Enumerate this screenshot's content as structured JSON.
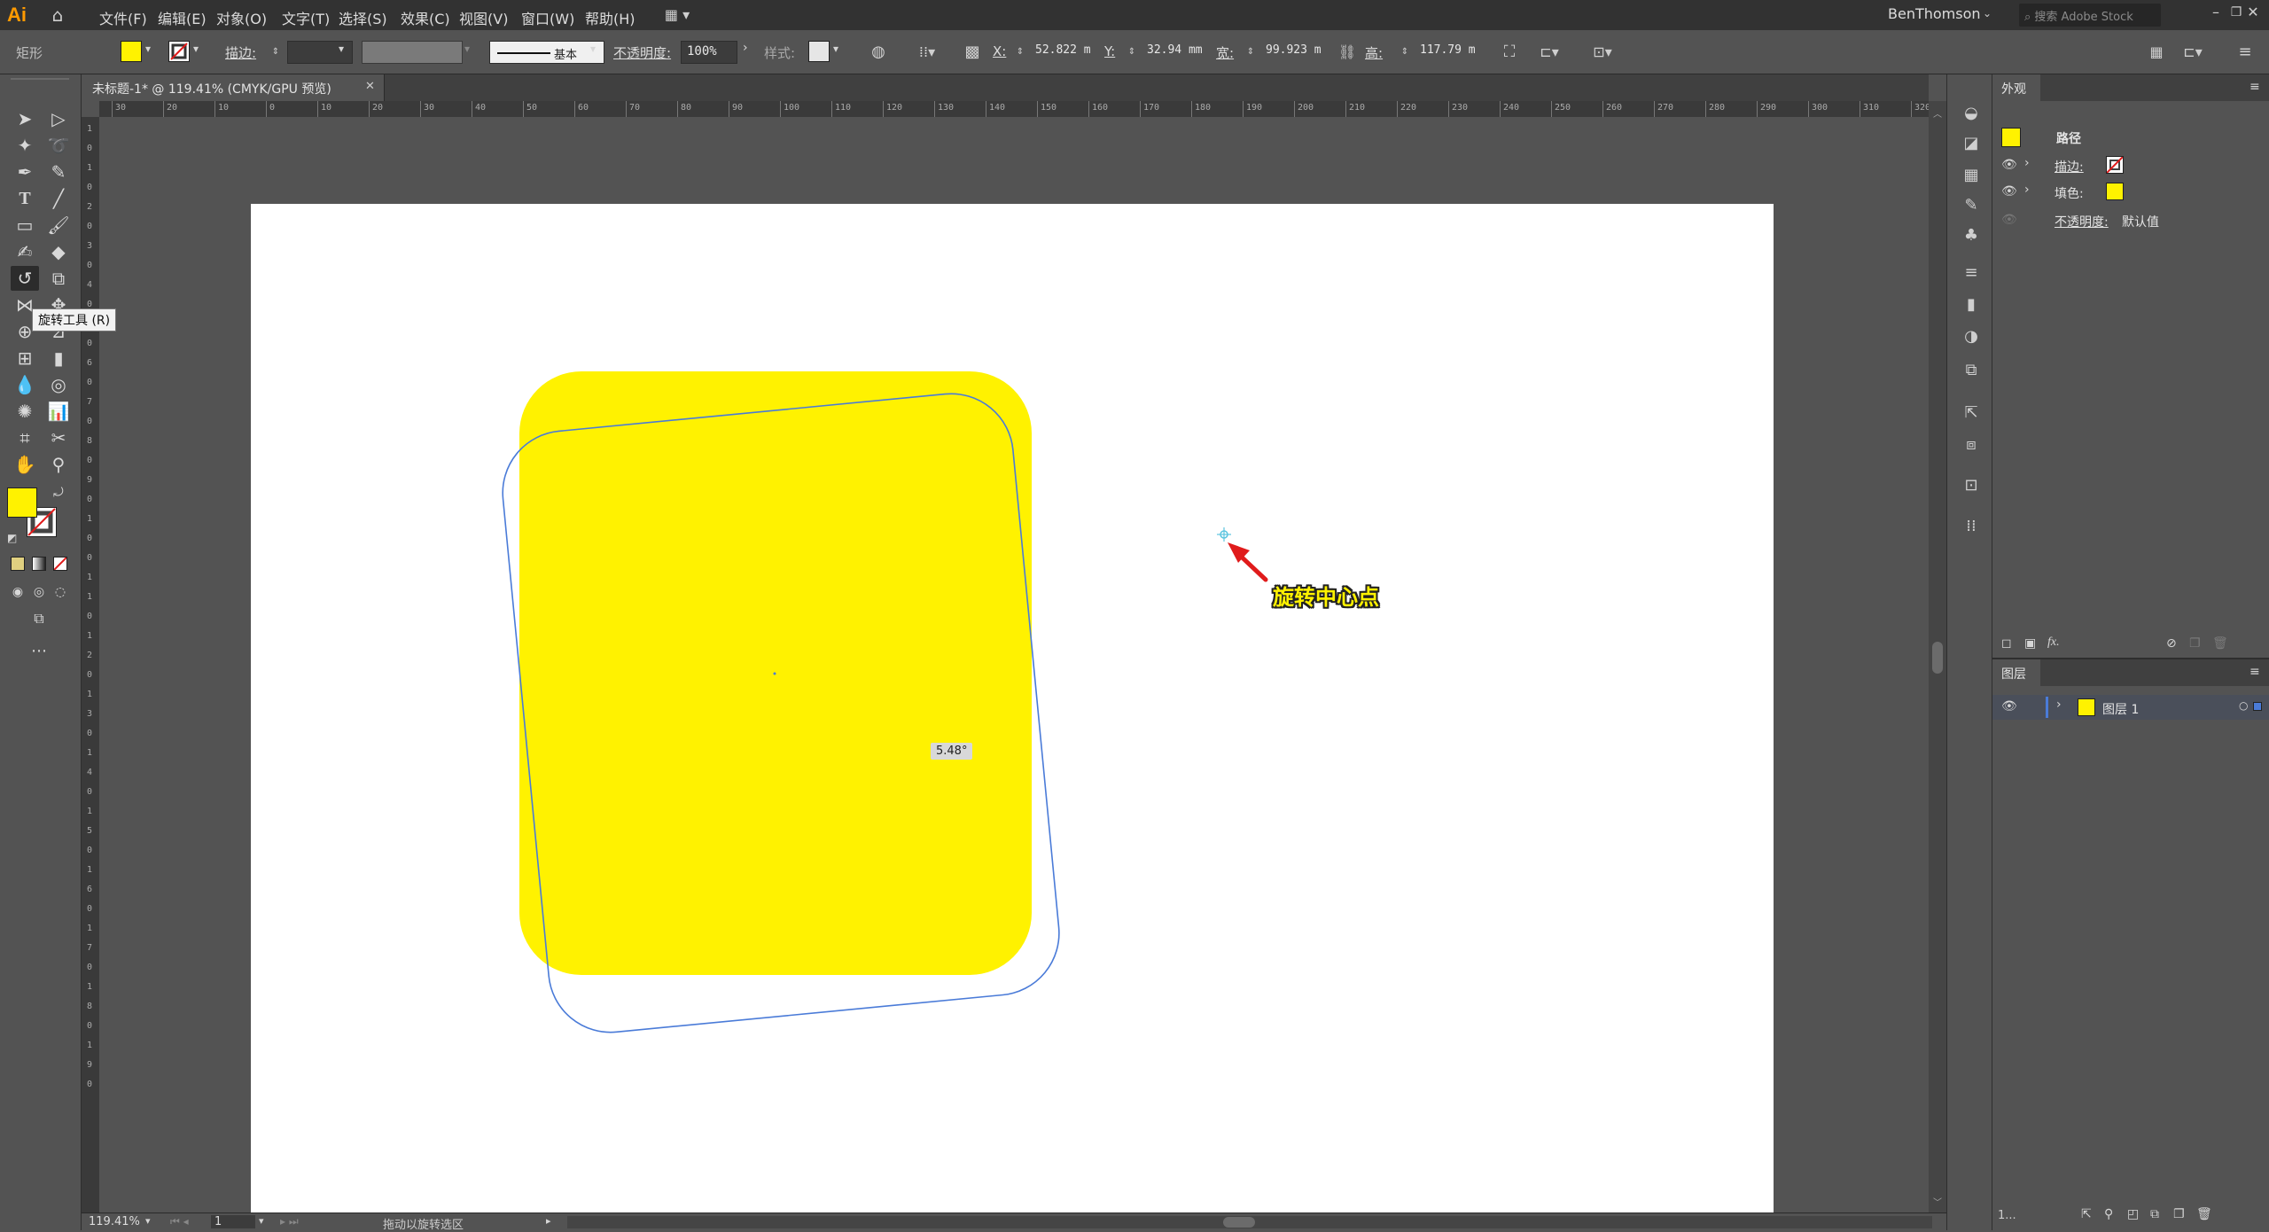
{
  "app": {
    "logo": "Ai"
  },
  "menu": [
    "文件(F)",
    "编辑(E)",
    "对象(O)",
    "文字(T)",
    "选择(S)",
    "效果(C)",
    "视图(V)",
    "窗口(W)",
    "帮助(H)"
  ],
  "user": {
    "name": "BenThomson",
    "search_placeholder": "搜索 Adobe Stock"
  },
  "control": {
    "object_type": "矩形",
    "stroke_label": "描边:",
    "stroke_profile": "基本",
    "opacity_label": "不透明度:",
    "opacity_value": "100%",
    "style_label": "样式:",
    "x_label": "X:",
    "x_value": "52.822 m",
    "y_label": "Y:",
    "y_value": "32.94 mm",
    "w_label": "宽:",
    "w_value": "99.923 m",
    "h_label": "高:",
    "h_value": "117.79 m",
    "fill_color": "#fff200"
  },
  "document_tab": {
    "title": "未标题-1* @ 119.41% (CMYK/GPU 预览)",
    "close": "✕"
  },
  "ruler_top_ticks": [
    "30",
    "20",
    "10",
    "0",
    "10",
    "20",
    "30",
    "40",
    "50",
    "60",
    "70",
    "80",
    "90",
    "100",
    "110",
    "120",
    "130",
    "140",
    "150",
    "160",
    "170",
    "180",
    "190",
    "200",
    "210",
    "220",
    "230",
    "240",
    "250",
    "260",
    "270",
    "280",
    "290",
    "300",
    "310",
    "320"
  ],
  "ruler_left_ticks": [
    "1",
    "0",
    "1",
    "0",
    "2",
    "0",
    "3",
    "0",
    "4",
    "0",
    "5",
    "0",
    "6",
    "0",
    "7",
    "0",
    "8",
    "0",
    "9",
    "0",
    "1",
    "0",
    "0",
    "1",
    "1",
    "0",
    "1",
    "2",
    "0",
    "1",
    "3",
    "0",
    "1",
    "4",
    "0",
    "1",
    "5",
    "0",
    "1",
    "6",
    "0",
    "1",
    "7",
    "0",
    "1",
    "8",
    "0",
    "1",
    "9",
    "0"
  ],
  "tooltip": "旋转工具 (R)",
  "artwork": {
    "fill": "#fff200",
    "path_color": "#4a7bd8",
    "rotation_badge": "5.48°",
    "annotation": "旋转中心点",
    "annotation_color": "#e01b1b"
  },
  "appearance_panel": {
    "title": "外观",
    "header": "路径",
    "rows": [
      {
        "label": "描边:",
        "swatch": "none"
      },
      {
        "label": "填色:",
        "swatch": "#fff200"
      }
    ],
    "opacity_label": "不透明度:",
    "opacity_value": "默认值",
    "fx": "fx."
  },
  "layers_panel": {
    "title": "图层",
    "layer_name": "图层 1",
    "layer_color": "#4a7bd8",
    "footer": "1..."
  },
  "status": {
    "zoom": "119.41%",
    "artboard": "1",
    "message": "拖动以旋转选区"
  }
}
